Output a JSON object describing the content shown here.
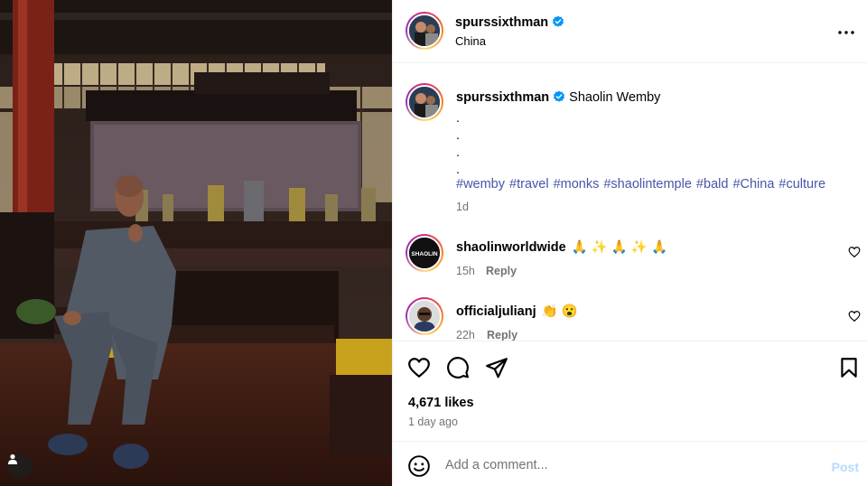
{
  "post": {
    "author": "spurssixthman",
    "location": "China",
    "caption": "Shaolin Wemby",
    "caption_dots": [
      ".",
      ".",
      ".",
      "."
    ],
    "hashtags": "#wemby #travel #monks #shaolintemple #bald #China #culture",
    "caption_time": "1d",
    "likes": "4,671 likes",
    "posted_ago": "1 day ago"
  },
  "comments": [
    {
      "user": "shaolinworldwide",
      "text": "🙏 ✨ 🙏 ✨ 🙏",
      "time": "15h",
      "reply": "Reply",
      "avatar_text": "SHAOLIN"
    },
    {
      "user": "officialjulianj",
      "text": "👏 😮",
      "time": "22h",
      "reply": "Reply"
    }
  ],
  "composer": {
    "placeholder": "Add a comment...",
    "post_label": "Post"
  },
  "colors": {
    "hashtag": "#4656a8",
    "verified": "#0095f6",
    "muted": "#737373",
    "post_disabled": "#b3dbff"
  },
  "icons": [
    "verified-badge-icon",
    "more-options-icon",
    "heart-icon",
    "comment-icon",
    "share-icon",
    "save-icon",
    "emoji-icon",
    "user-tag-icon"
  ]
}
